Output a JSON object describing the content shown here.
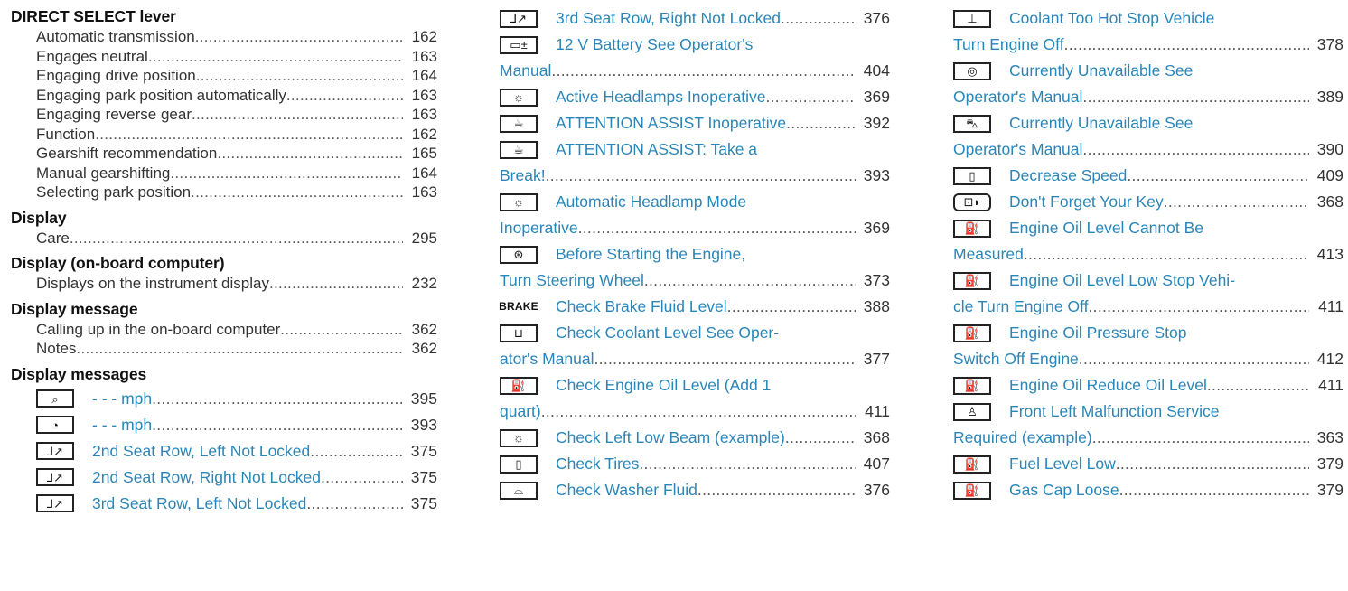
{
  "col1": {
    "sections": [
      {
        "heading": "DIRECT SELECT lever",
        "items": [
          {
            "label": "Automatic transmission",
            "page": "162"
          },
          {
            "label": "Engages neutral",
            "page": "163"
          },
          {
            "label": "Engaging drive position",
            "page": "164"
          },
          {
            "label": "Engaging park position automatically",
            "page": "163"
          },
          {
            "label": "Engaging reverse gear",
            "page": "163"
          },
          {
            "label": "Function",
            "page": "162"
          },
          {
            "label": "Gearshift recommendation",
            "page": "165"
          },
          {
            "label": "Manual gearshifting",
            "page": "164"
          },
          {
            "label": "Selecting park position",
            "page": "163"
          }
        ]
      },
      {
        "heading": "Display",
        "items": [
          {
            "label": "Care",
            "page": "295"
          }
        ]
      },
      {
        "heading": "Display (on-board computer)",
        "items": [
          {
            "label": "Displays on the instrument display",
            "page": "232"
          }
        ]
      },
      {
        "heading": "Display message",
        "items": [
          {
            "label": "Calling up in the on-board computer",
            "page": "362"
          },
          {
            "label": "Notes",
            "page": "362"
          }
        ]
      },
      {
        "heading": "Display messages",
        "items": []
      }
    ],
    "entries": [
      {
        "icon": "speed-limit-camera-icon",
        "glyph": "⌕",
        "label": "- - - mph",
        "page": "395"
      },
      {
        "icon": "speedometer-icon",
        "glyph": "◔",
        "label": "- - - mph",
        "page": "393"
      },
      {
        "icon": "seat-icon",
        "glyph": "⅃↗",
        "label": "2nd Seat Row, Left Not Locked",
        "page": "375"
      },
      {
        "icon": "seat-icon",
        "glyph": "⅃↗",
        "label": "2nd Seat Row, Right Not Locked",
        "page": "375"
      },
      {
        "icon": "seat-icon",
        "glyph": "⅃↗",
        "label": "3rd Seat Row, Left Not Locked",
        "page": "375"
      }
    ]
  },
  "col2": {
    "entries": [
      {
        "icon": "seat-icon",
        "glyph": "⅃↗",
        "lines": [
          "3rd Seat Row, Right Not Locked"
        ],
        "page": "376"
      },
      {
        "icon": "battery-icon",
        "glyph": "▭±",
        "lines": [
          "12 V Battery See Operator's",
          "Manual"
        ],
        "page": "404"
      },
      {
        "icon": "headlamp-icon",
        "glyph": "☼",
        "lines": [
          "Active Headlamps Inoperative"
        ],
        "page": "369"
      },
      {
        "icon": "coffee-cup-icon",
        "glyph": "☕",
        "lines": [
          "ATTENTION ASSIST Inoperative"
        ],
        "page": "392"
      },
      {
        "icon": "coffee-cup-icon",
        "glyph": "☕",
        "lines": [
          "ATTENTION ASSIST: Take a",
          "Break!"
        ],
        "page": "393"
      },
      {
        "icon": "headlamp-icon",
        "glyph": "☼",
        "lines": [
          "Automatic Headlamp Mode",
          "Inoperative"
        ],
        "page": "369"
      },
      {
        "icon": "steering-wheel-icon",
        "glyph": "⊛",
        "lines": [
          "Before Starting the Engine,",
          "Turn Steering Wheel"
        ],
        "page": "373"
      },
      {
        "icon": "brake-icon",
        "glyph": "BRAKE",
        "lines": [
          "Check Brake Fluid Level"
        ],
        "page": "388"
      },
      {
        "icon": "coolant-level-icon",
        "glyph": "⊔",
        "lines": [
          "Check Coolant Level See Oper-",
          "ator's Manual"
        ],
        "page": "377"
      },
      {
        "icon": "oil-can-icon",
        "glyph": "⛽",
        "lines": [
          "Check Engine Oil Level (Add 1",
          "quart)"
        ],
        "page": "411"
      },
      {
        "icon": "headlamp-icon",
        "glyph": "☼",
        "lines": [
          "Check Left Low Beam (example)"
        ],
        "page": "368"
      },
      {
        "icon": "tire-icon",
        "glyph": "▯",
        "lines": [
          "Check Tires"
        ],
        "page": "407"
      },
      {
        "icon": "washer-fluid-icon",
        "glyph": "⌓",
        "lines": [
          "Check Washer Fluid"
        ],
        "page": "376"
      }
    ]
  },
  "col3": {
    "entries": [
      {
        "icon": "coolant-temperature-icon",
        "glyph": "⊥",
        "lines": [
          "Coolant Too Hot Stop Vehicle",
          "Turn Engine Off"
        ],
        "page": "378"
      },
      {
        "icon": "abs-icon",
        "glyph": "◎",
        "lines": [
          "Currently Unavailable See",
          "Operator's Manual"
        ],
        "page": "389"
      },
      {
        "icon": "car-icon",
        "glyph": "⛍",
        "lines": [
          "Currently Unavailable See",
          "Operator's Manual"
        ],
        "page": "390"
      },
      {
        "icon": "tire-icon",
        "glyph": "▯",
        "lines": [
          "Decrease Speed"
        ],
        "page": "409"
      },
      {
        "icon": "key-icon",
        "glyph": "⊡◗",
        "lines": [
          "Don't Forget Your Key"
        ],
        "page": "368"
      },
      {
        "icon": "oil-can-icon",
        "glyph": "⛽",
        "lines": [
          "Engine Oil Level Cannot Be",
          "Measured"
        ],
        "page": "413"
      },
      {
        "icon": "oil-can-icon",
        "glyph": "⛽",
        "lines": [
          "Engine Oil Level Low Stop Vehi-",
          "cle Turn Engine Off"
        ],
        "page": "411"
      },
      {
        "icon": "oil-can-icon",
        "glyph": "⛽",
        "lines": [
          "Engine Oil Pressure Stop",
          "Switch Off Engine"
        ],
        "page": "412"
      },
      {
        "icon": "oil-can-icon",
        "glyph": "⛽",
        "lines": [
          "Engine Oil Reduce Oil Level"
        ],
        "page": "411"
      },
      {
        "icon": "airbag-icon",
        "glyph": "♙",
        "lines": [
          "Front Left Malfunction Service",
          "Required (example)"
        ],
        "page": "363"
      },
      {
        "icon": "fuel-pump-icon",
        "glyph": "⛽",
        "lines": [
          "Fuel Level Low"
        ],
        "page": "379"
      },
      {
        "icon": "fuel-pump-icon",
        "glyph": "⛽",
        "lines": [
          "Gas Cap Loose"
        ],
        "page": "379"
      }
    ]
  }
}
